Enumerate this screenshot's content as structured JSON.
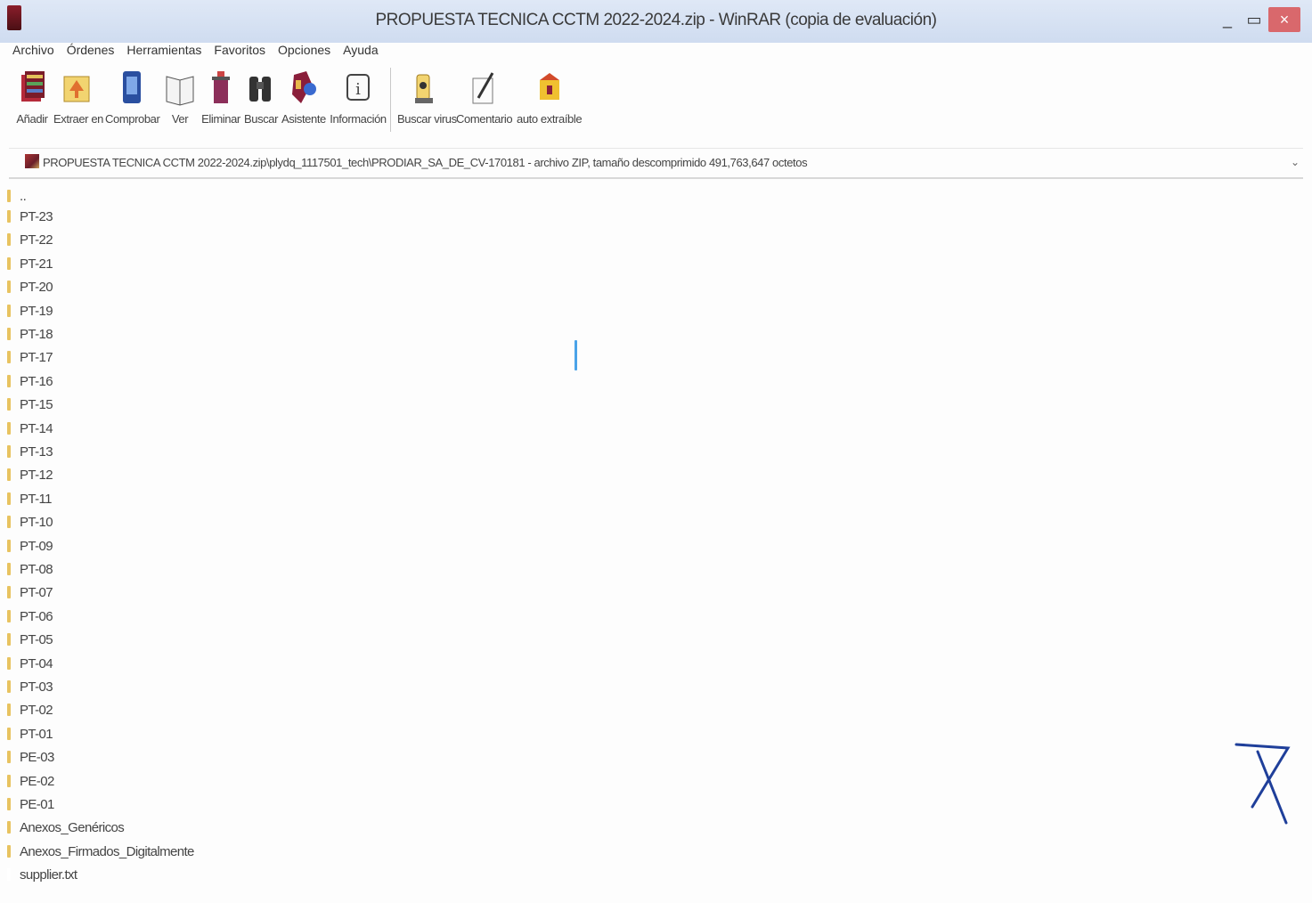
{
  "window": {
    "title": "PROPUESTA TECNICA CCTM 2022-2024.zip - WinRAR (copia de evaluación)",
    "controls": {
      "minimize": "_",
      "maximize": "▭",
      "close": "×"
    }
  },
  "menu": {
    "items": [
      "Archivo",
      "Órdenes",
      "Herramientas",
      "Favoritos",
      "Opciones",
      "Ayuda"
    ]
  },
  "toolbar": {
    "buttons": [
      {
        "label": "Añadir",
        "icon": "add-archive-icon"
      },
      {
        "label": "Extraer en",
        "icon": "extract-folder-icon"
      },
      {
        "label": "Comprobar",
        "icon": "test-archive-icon"
      },
      {
        "label": "Ver",
        "icon": "view-book-icon"
      },
      {
        "label": "Eliminar",
        "icon": "delete-bin-icon"
      },
      {
        "label": "Buscar",
        "icon": "binoculars-icon"
      },
      {
        "label": "Asistente",
        "icon": "wizard-icon"
      },
      {
        "label": "Información",
        "icon": "info-icon"
      },
      {
        "label": "Buscar virus",
        "icon": "virus-scan-icon"
      },
      {
        "label": "Comentario",
        "icon": "comment-pen-icon"
      },
      {
        "label": "auto extraíble",
        "icon": "sfx-icon"
      }
    ]
  },
  "address": {
    "path": "PROPUESTA TECNICA CCTM 2022-2024.zip\\plydq_1117501_tech\\PRODIAR_SA_DE_CV-170181 - archivo ZIP, tamaño descomprimido 491,763,647 octetos"
  },
  "files": [
    {
      "name": "..",
      "type": "folder"
    },
    {
      "name": "PT-23",
      "type": "folder"
    },
    {
      "name": "PT-22",
      "type": "folder"
    },
    {
      "name": "PT-21",
      "type": "folder"
    },
    {
      "name": "PT-20",
      "type": "folder"
    },
    {
      "name": "PT-19",
      "type": "folder"
    },
    {
      "name": "PT-18",
      "type": "folder"
    },
    {
      "name": "PT-17",
      "type": "folder"
    },
    {
      "name": "PT-16",
      "type": "folder"
    },
    {
      "name": "PT-15",
      "type": "folder"
    },
    {
      "name": "PT-14",
      "type": "folder"
    },
    {
      "name": "PT-13",
      "type": "folder"
    },
    {
      "name": "PT-12",
      "type": "folder"
    },
    {
      "name": "PT-11",
      "type": "folder"
    },
    {
      "name": "PT-10",
      "type": "folder"
    },
    {
      "name": "PT-09",
      "type": "folder"
    },
    {
      "name": "PT-08",
      "type": "folder"
    },
    {
      "name": "PT-07",
      "type": "folder"
    },
    {
      "name": "PT-06",
      "type": "folder"
    },
    {
      "name": "PT-05",
      "type": "folder"
    },
    {
      "name": "PT-04",
      "type": "folder"
    },
    {
      "name": "PT-03",
      "type": "folder"
    },
    {
      "name": "PT-02",
      "type": "folder"
    },
    {
      "name": "PT-01",
      "type": "folder"
    },
    {
      "name": "PE-03",
      "type": "folder"
    },
    {
      "name": "PE-02",
      "type": "folder"
    },
    {
      "name": "PE-01",
      "type": "folder"
    },
    {
      "name": "Anexos_Genéricos",
      "type": "folder"
    },
    {
      "name": "Anexos_Firmados_Digitalmente",
      "type": "folder"
    },
    {
      "name": "supplier.txt",
      "type": "file"
    }
  ],
  "colors": {
    "titlebar": "#dfe8f6",
    "close_button": "#d9686c",
    "folder": "#e8c360",
    "cursor": "#4aa3e8",
    "signature_ink": "#1f3f9a"
  }
}
